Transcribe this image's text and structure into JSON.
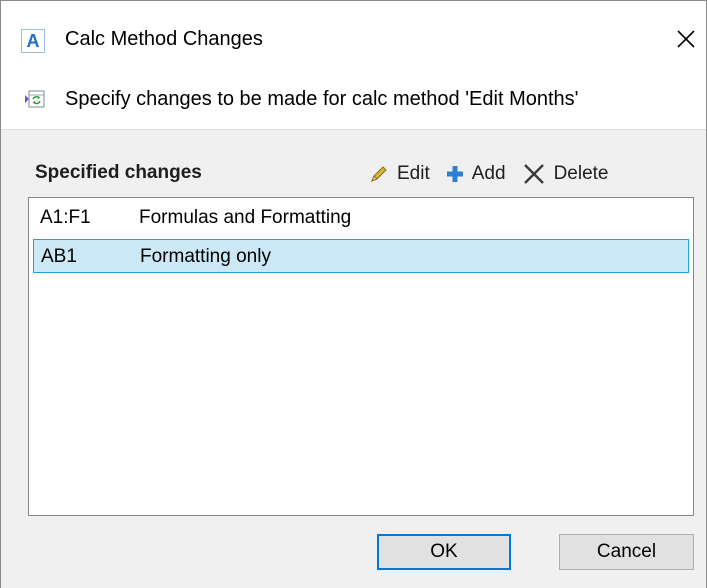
{
  "window": {
    "title": "Calc Method Changes",
    "app_icon_letter": "A",
    "close_glyph": "close-icon"
  },
  "header": {
    "subtitle": "Specify changes to be made for calc method 'Edit Months'",
    "icon": "refresh-sheet-icon"
  },
  "section": {
    "label": "Specified changes"
  },
  "toolbar": {
    "edit_label": "Edit",
    "add_label": "Add",
    "delete_label": "Delete",
    "edit_icon": "pencil-icon",
    "add_icon": "plus-icon",
    "delete_icon": "x-icon"
  },
  "changes": [
    {
      "range": "A1:F1",
      "type": "Formulas and Formatting",
      "selected": false
    },
    {
      "range": "AB1",
      "type": "Formatting only",
      "selected": true
    }
  ],
  "buttons": {
    "ok_label": "OK",
    "cancel_label": "Cancel"
  },
  "colors": {
    "selection_bg": "#cce8f6",
    "selection_border": "#26a0da",
    "accent": "#0078d7",
    "add_icon": "#2f7fd1",
    "edit_icon": "#c9a227"
  }
}
